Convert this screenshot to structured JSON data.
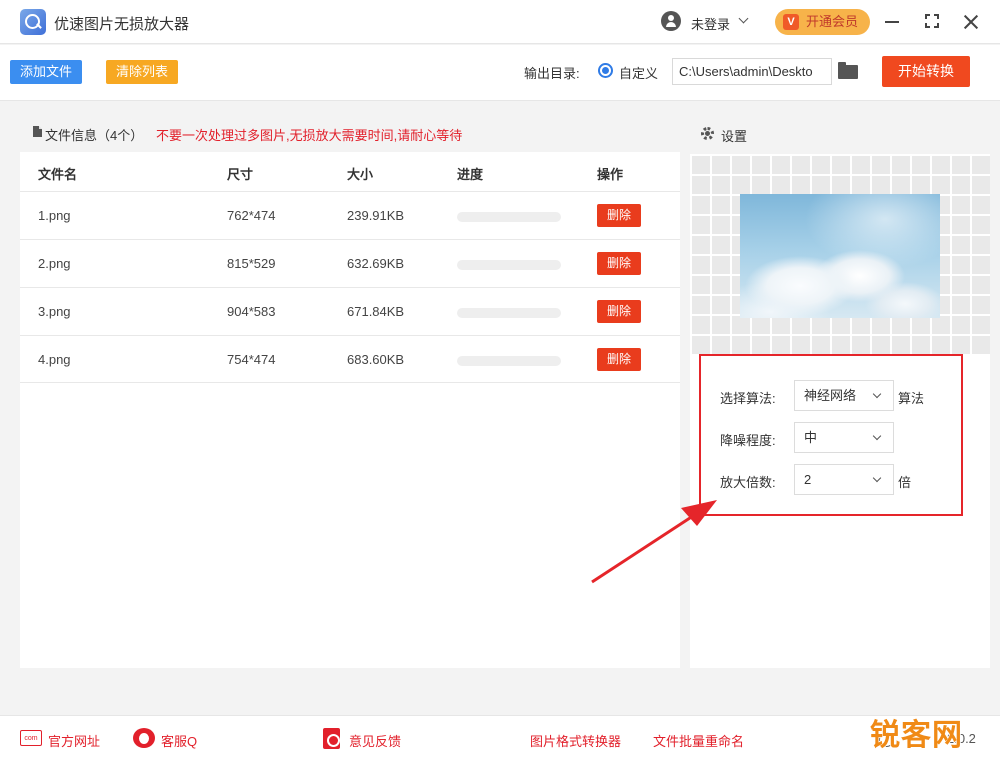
{
  "app": {
    "title": "优速图片无损放大器"
  },
  "titlebar": {
    "user_label": "未登录",
    "vip_label": "开通会员",
    "vip_icon_char": "V"
  },
  "toolbar": {
    "add_label": "添加文件",
    "clear_label": "清除列表",
    "output_label": "输出目录:",
    "radio_label": "自定义",
    "path_value": "C:\\Users\\admin\\Deskto",
    "start_label": "开始转换"
  },
  "files": {
    "title": "文件信息（4个）",
    "warning": "不要一次处理过多图片,无损放大需要时间,请耐心等待",
    "columns": [
      "文件名",
      "尺寸",
      "大小",
      "进度",
      "操作"
    ],
    "delete_label": "删除",
    "rows": [
      {
        "name": "1.png",
        "size": "762*474",
        "filesize": "239.91KB",
        "progress": 0
      },
      {
        "name": "2.png",
        "size": "815*529",
        "filesize": "632.69KB",
        "progress": 0
      },
      {
        "name": "3.png",
        "size": "904*583",
        "filesize": "671.84KB",
        "progress": 0
      },
      {
        "name": "4.png",
        "size": "754*474",
        "filesize": "683.60KB",
        "progress": 0
      }
    ]
  },
  "settings": {
    "title": "设置",
    "algorithm_label": "选择算法:",
    "algorithm_value": "神经网络",
    "algorithm_suffix": "算法",
    "denoise_label": "降噪程度:",
    "denoise_value": "中",
    "scale_label": "放大倍数:",
    "scale_value": "2",
    "scale_suffix": "倍"
  },
  "footer": {
    "website": "官方网址",
    "support": "客服Q",
    "feedback": "意见反馈",
    "converter": "图片格式转换器",
    "rename": "文件批量重命名",
    "version": "2.0.2",
    "com_icon_text": "com"
  },
  "watermark": "锐客网",
  "colors": {
    "primary_blue": "#3b8ef0",
    "orange": "#f7a822",
    "start_red": "#f0491f",
    "delete_red": "#e93c1d",
    "warning_red": "#e2202b",
    "vip_gold": "#f7b34a",
    "annotation_red": "#e5252a"
  }
}
